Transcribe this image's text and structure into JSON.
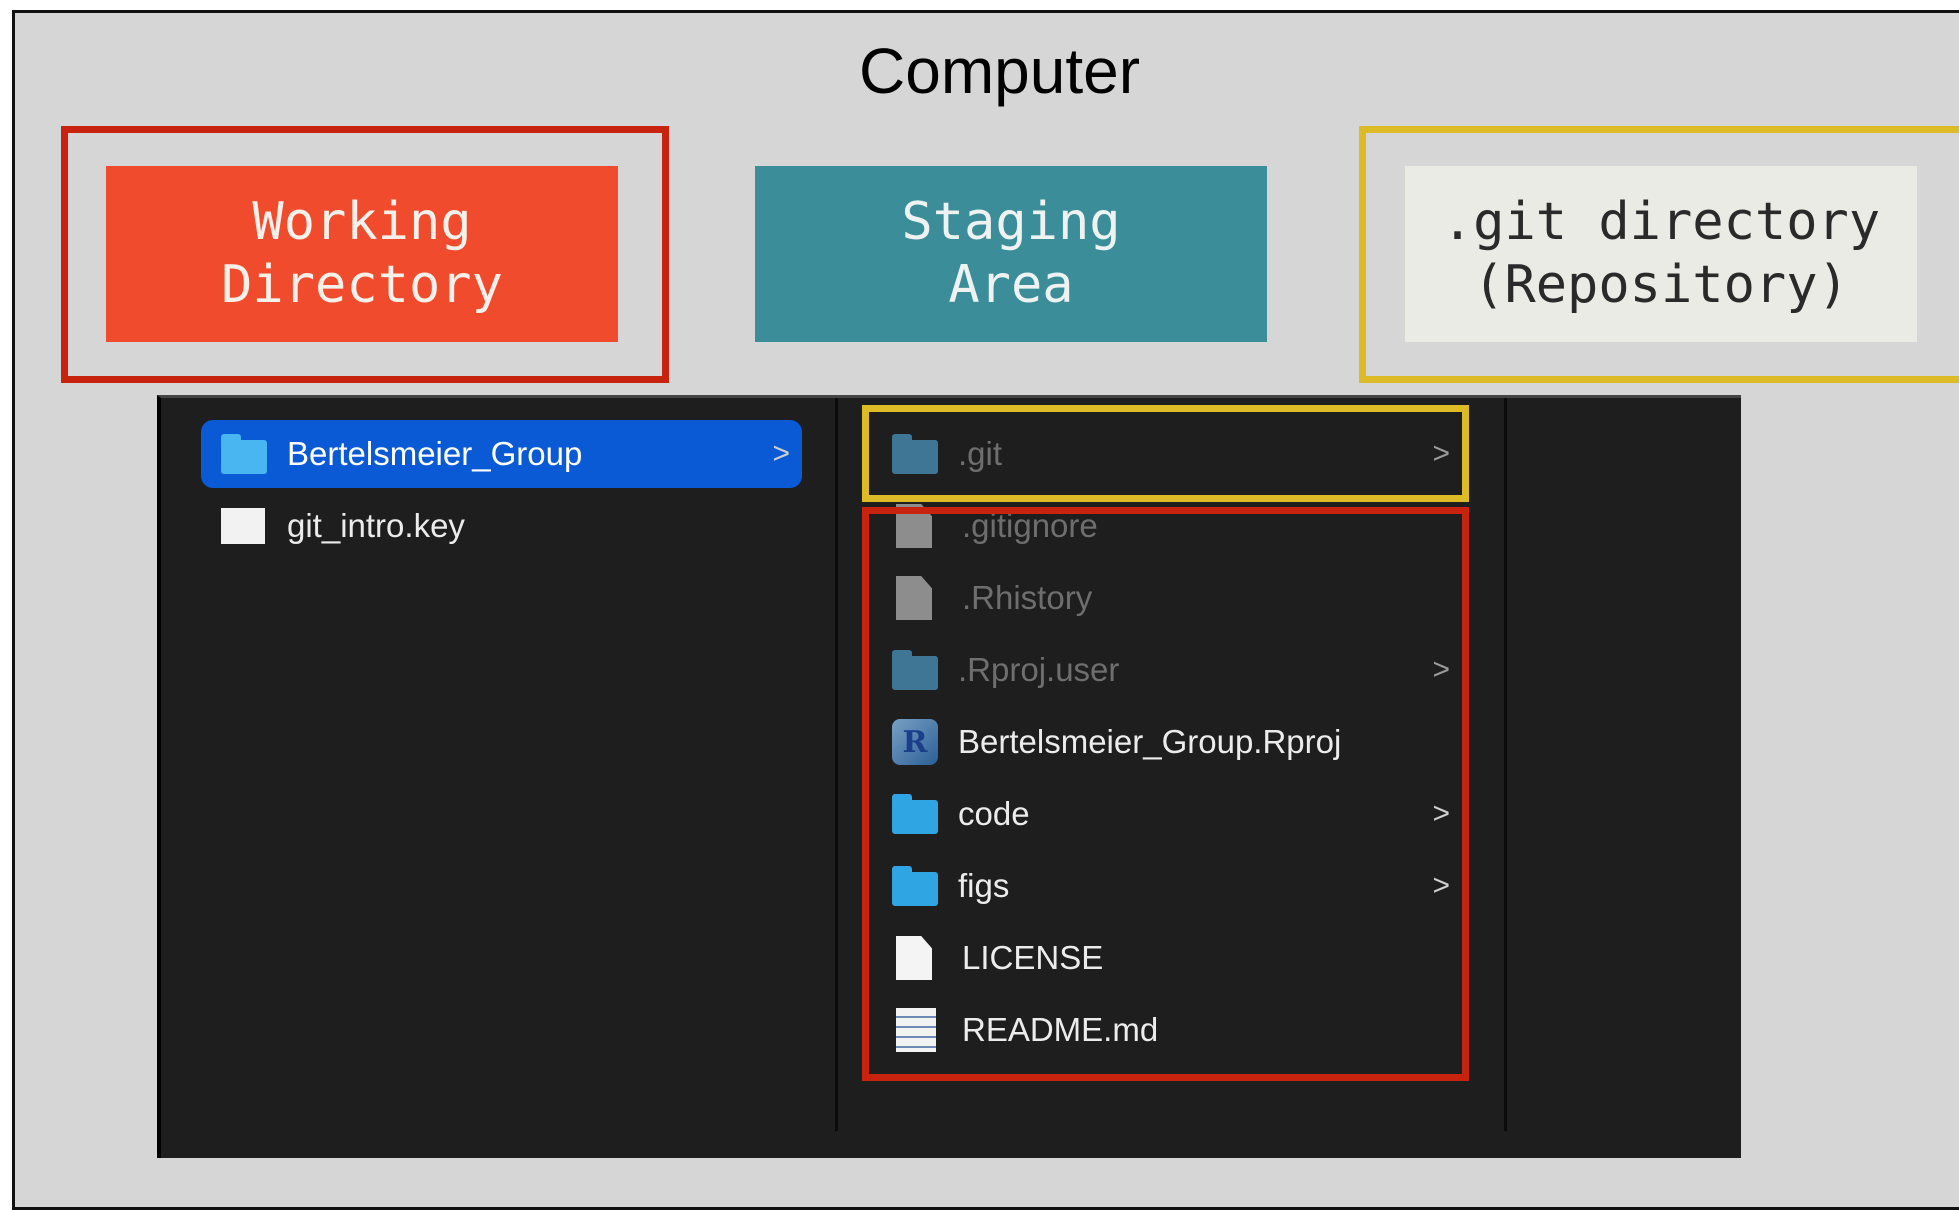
{
  "title": "Computer",
  "boxes": {
    "working": "Working\nDirectory",
    "staging": "Staging\nArea",
    "git": ".git directory\n(Repository)"
  },
  "colors": {
    "working_fill": "#ef4b2c",
    "staging_fill": "#3b8e99",
    "git_fill": "#e9ebe4",
    "highlight_red": "#c8230f",
    "highlight_yellow": "#dcbb26",
    "finder_bg": "#1e1e1e",
    "selection": "#0a5ad6"
  },
  "finder": {
    "col1": [
      {
        "name": "Bertelsmeier_Group",
        "icon": "folder-icon",
        "selected": true,
        "has_children": true
      },
      {
        "name": "git_intro.key",
        "icon": "keynote-file-icon",
        "selected": false,
        "has_children": false
      }
    ],
    "col2": [
      {
        "name": ".git",
        "icon": "folder-icon",
        "hidden": true,
        "has_children": true
      },
      {
        "name": ".gitignore",
        "icon": "document-icon",
        "hidden": true,
        "has_children": false
      },
      {
        "name": ".Rhistory",
        "icon": "document-icon",
        "hidden": true,
        "has_children": false
      },
      {
        "name": ".Rproj.user",
        "icon": "folder-icon",
        "hidden": true,
        "has_children": true
      },
      {
        "name": "Bertelsmeier_Group.Rproj",
        "icon": "rproject-icon",
        "hidden": false,
        "has_children": false
      },
      {
        "name": "code",
        "icon": "folder-icon",
        "hidden": false,
        "has_children": true
      },
      {
        "name": "figs",
        "icon": "folder-icon",
        "hidden": false,
        "has_children": true
      },
      {
        "name": "LICENSE",
        "icon": "document-icon",
        "hidden": false,
        "has_children": false
      },
      {
        "name": "README.md",
        "icon": "text-document-icon",
        "hidden": false,
        "has_children": false
      }
    ],
    "chevron": ">",
    "rproj_glyph": "R"
  }
}
